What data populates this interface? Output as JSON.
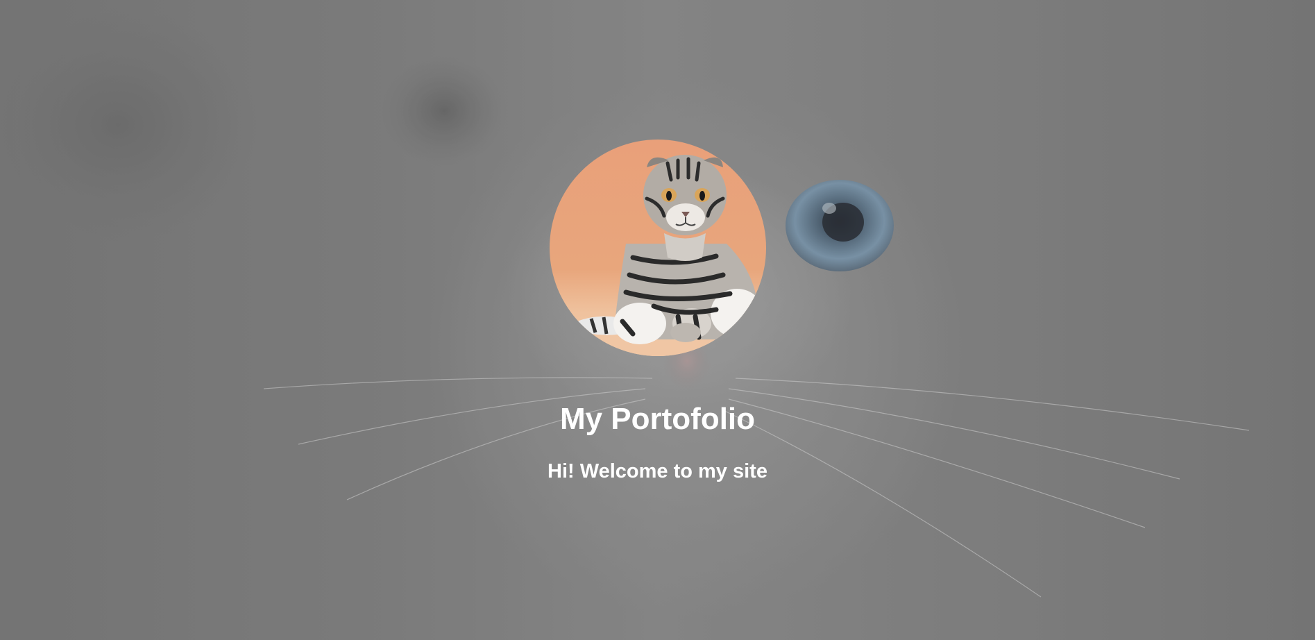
{
  "hero": {
    "background_image": "white-cat-closeup-background",
    "avatar_image": "tabby-scottish-fold-cat-avatar",
    "title": "My Portofolio",
    "subtitle": "Hi! Welcome to my site"
  },
  "colors": {
    "text": "#ffffff",
    "overlay": "#808080",
    "avatar_bg": "#e8a57a",
    "cat_eye": "#7f9db5"
  }
}
